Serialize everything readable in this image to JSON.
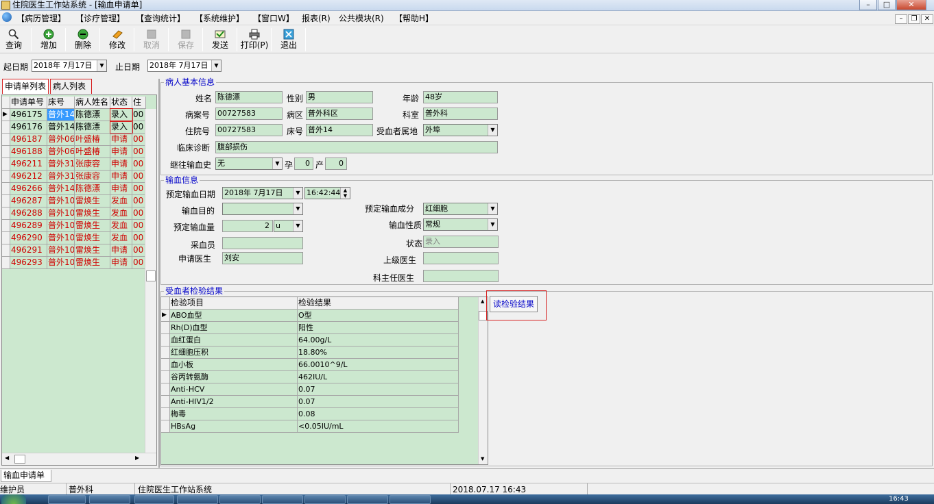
{
  "window": {
    "title": "住院医生工作站系统 - [输血申请单]",
    "min": "–",
    "max": "□",
    "close": "✕"
  },
  "menu": [
    "【病历管理】",
    "【诊疗管理】",
    "【查询统计】",
    "【系统维护】",
    "【窗口W】",
    "报表(R)",
    "公共模块(R)",
    "【帮助H】"
  ],
  "mdi_buttons": [
    "–",
    "❐",
    "✕"
  ],
  "toolbar": [
    {
      "label": "查询",
      "icon": "search-icon",
      "enabled": true
    },
    {
      "label": "增加",
      "icon": "add-icon",
      "enabled": true
    },
    {
      "label": "删除",
      "icon": "delete-icon",
      "enabled": true
    },
    {
      "label": "修改",
      "icon": "edit-icon",
      "enabled": true
    },
    {
      "label": "取消",
      "icon": "cancel-icon",
      "enabled": false
    },
    {
      "label": "保存",
      "icon": "save-icon",
      "enabled": false
    },
    {
      "label": "发送",
      "icon": "send-icon",
      "enabled": true
    },
    {
      "label": "打印(P)",
      "icon": "printer-icon",
      "enabled": true
    },
    {
      "label": "退出",
      "icon": "exit-icon",
      "enabled": true
    }
  ],
  "dates": {
    "start_label": "起日期",
    "start_value": "2018年 7月17日",
    "end_label": "止日期",
    "end_value": "2018年 7月17日"
  },
  "tabs": [
    "申请单列表",
    "病人列表"
  ],
  "left_list": {
    "columns": [
      "申请单号",
      "床号",
      "病人姓名",
      "状态",
      "住"
    ],
    "rows": [
      {
        "id": "496175",
        "bed": "普外14",
        "name": "陈德漂",
        "status": "录入",
        "extra": "00",
        "red": false
      },
      {
        "id": "496176",
        "bed": "普外14",
        "name": "陈德漂",
        "status": "录入",
        "extra": "00",
        "red": false
      },
      {
        "id": "496187",
        "bed": "普外06",
        "name": "叶盛椿",
        "status": "申请",
        "extra": "00",
        "red": true
      },
      {
        "id": "496188",
        "bed": "普外06",
        "name": "叶盛椿",
        "status": "申请",
        "extra": "00",
        "red": true
      },
      {
        "id": "496211",
        "bed": "普外31",
        "name": "张康容",
        "status": "申请",
        "extra": "00",
        "red": true
      },
      {
        "id": "496212",
        "bed": "普外31",
        "name": "张康容",
        "status": "申请",
        "extra": "00",
        "red": true
      },
      {
        "id": "496266",
        "bed": "普外14",
        "name": "陈德漂",
        "status": "申请",
        "extra": "00",
        "red": true
      },
      {
        "id": "496287",
        "bed": "普外10",
        "name": "雷焕生",
        "status": "发血",
        "extra": "00",
        "red": true
      },
      {
        "id": "496288",
        "bed": "普外10",
        "name": "雷焕生",
        "status": "发血",
        "extra": "00",
        "red": true
      },
      {
        "id": "496289",
        "bed": "普外10",
        "name": "雷焕生",
        "status": "发血",
        "extra": "00",
        "red": true
      },
      {
        "id": "496290",
        "bed": "普外10",
        "name": "雷焕生",
        "status": "发血",
        "extra": "00",
        "red": true
      },
      {
        "id": "496291",
        "bed": "普外10",
        "name": "雷焕生",
        "status": "申请",
        "extra": "00",
        "red": true
      },
      {
        "id": "496293",
        "bed": "普外10",
        "name": "雷焕生",
        "status": "申请",
        "extra": "00",
        "red": true
      }
    ]
  },
  "patient": {
    "section_title": "病人基本信息",
    "name_label": "姓名",
    "name": "陈德漂",
    "gender_label": "性别",
    "gender": "男",
    "age_label": "年龄",
    "age": "48岁",
    "caseno_label": "病案号",
    "caseno": "00727583",
    "ward_label": "病区",
    "ward": "普外科区",
    "dept_label": "科室",
    "dept": "普外科",
    "inpatient_label": "住院号",
    "inpatient": "00727583",
    "bed_label": "床号",
    "bed": "普外14",
    "place_label": "受血者属地",
    "place": "外埠",
    "diag_label": "临床诊断",
    "diag": "腹部损伤",
    "history_label": "继往输血史",
    "history": "无",
    "preg_label": "孕",
    "preg": "0",
    "birth_label": "产",
    "birth": "0"
  },
  "transfusion": {
    "section_title": "输血信息",
    "date_label": "预定输血日期",
    "date": "2018年 7月17日",
    "time": "16:42:44",
    "purpose_label": "输血目的",
    "purpose": "",
    "component_label": "预定输血成分",
    "component": "红细胞",
    "amount_label": "预定输血量",
    "amount": "2",
    "unit": "u",
    "nature_label": "输血性质",
    "nature": "常规",
    "collector_label": "采血员",
    "collector": "",
    "state_label": "状态",
    "state": "录入",
    "doctor_label": "申请医生",
    "doctor": "刘安",
    "senior_label": "上级医生",
    "senior": "",
    "director_label": "科主任医生",
    "director": ""
  },
  "results": {
    "section_title": "受血者检验结果",
    "read_button": "读检验结果",
    "columns": [
      "检验项目",
      "检验结果"
    ],
    "rows": [
      {
        "item": "ABO血型",
        "value": "O型"
      },
      {
        "item": "Rh(D)血型",
        "value": "阳性"
      },
      {
        "item": "血红蛋白",
        "value": "64.00g/L"
      },
      {
        "item": "红细胞压积",
        "value": "18.80%"
      },
      {
        "item": "血小板",
        "value": "66.0010^9/L"
      },
      {
        "item": "谷丙转氨酶",
        "value": "462IU/L"
      },
      {
        "item": "Anti-HCV",
        "value": "0.07"
      },
      {
        "item": "Anti-HIV1/2",
        "value": "0.07"
      },
      {
        "item": "梅毒",
        "value": "0.08"
      },
      {
        "item": "HBsAg",
        "value": "<0.05IU/mL"
      }
    ]
  },
  "bottom_tab": "输血申请单",
  "status": {
    "user": "维护员",
    "dept": "普外科",
    "system": "住院医生工作站系统",
    "datetime": "2018.07.17 16:43"
  },
  "clock": "16:43",
  "colors": {
    "field_green": "#cce8cf",
    "section_blue": "#0000c8",
    "row_red": "#d00000",
    "highlight": "#d62020"
  }
}
